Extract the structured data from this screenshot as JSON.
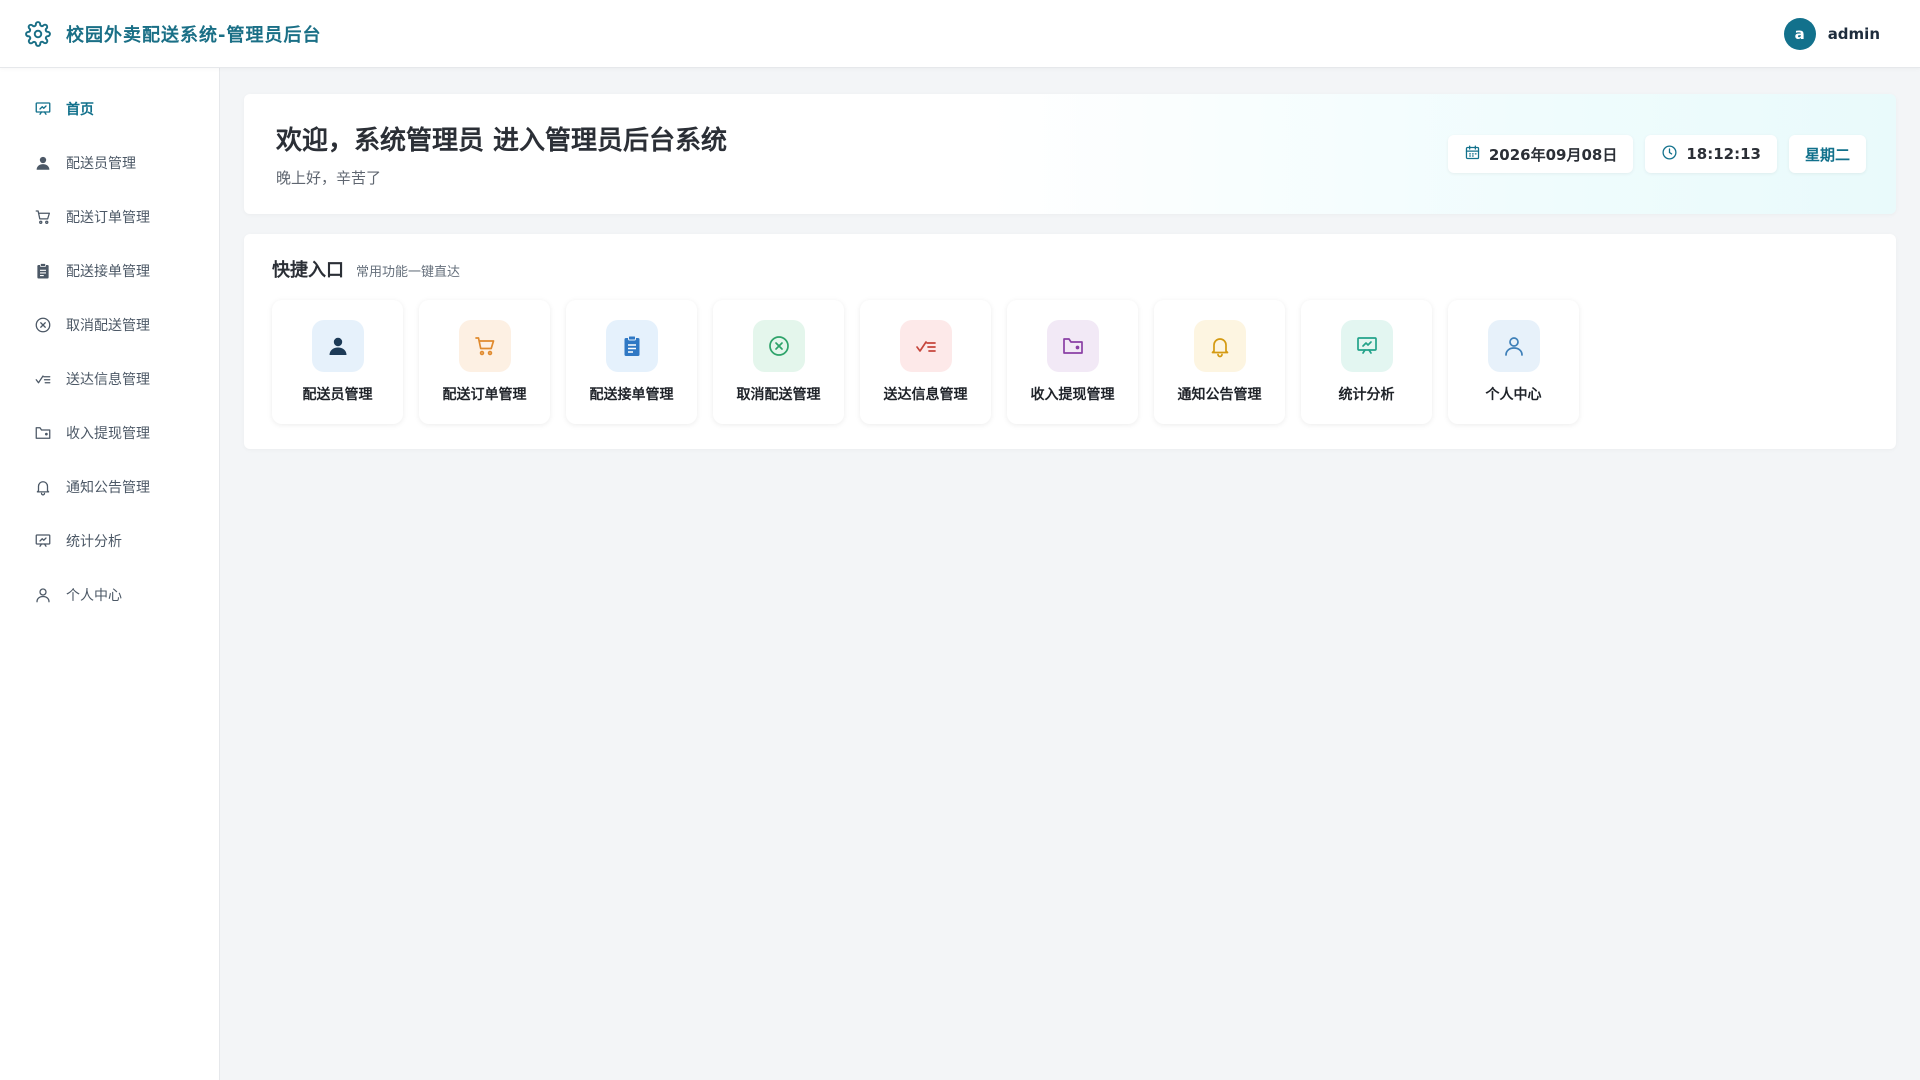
{
  "header": {
    "title": "校园外卖配送系统-管理员后台",
    "logo_icon": "gear-icon",
    "user": {
      "avatar_letter": "a",
      "name": "admin"
    }
  },
  "sidebar": {
    "active_color": "#12718c",
    "items": [
      {
        "label": "首页",
        "icon": "presentation-chart-icon",
        "active": true
      },
      {
        "label": "配送员管理",
        "icon": "user-icon",
        "active": false
      },
      {
        "label": "配送订单管理",
        "icon": "cart-icon",
        "active": false
      },
      {
        "label": "配送接单管理",
        "icon": "clipboard-icon",
        "active": false
      },
      {
        "label": "取消配送管理",
        "icon": "circle-x-icon",
        "active": false
      },
      {
        "label": "送达信息管理",
        "icon": "check-list-icon",
        "active": false
      },
      {
        "label": "收入提现管理",
        "icon": "wallet-icon",
        "active": false
      },
      {
        "label": "通知公告管理",
        "icon": "bell-icon",
        "active": false
      },
      {
        "label": "统计分析",
        "icon": "presentation-chart-icon",
        "active": false
      },
      {
        "label": "个人中心",
        "icon": "user-outline-icon",
        "active": false
      }
    ]
  },
  "welcome": {
    "title": "欢迎，系统管理员 进入管理员后台系统",
    "subtitle": "晚上好，辛苦了",
    "date": "2026年09月08日",
    "time": "18:12:13",
    "weekday": "星期二"
  },
  "quick": {
    "title": "快捷入口",
    "subtitle": "常用功能一键直达",
    "tiles": [
      {
        "label": "配送员管理",
        "icon": "user-icon",
        "bg": "#e6f1fb",
        "color": "#1d3b57"
      },
      {
        "label": "配送订单管理",
        "icon": "cart-icon",
        "bg": "#fdf0e3",
        "color": "#e08a2e"
      },
      {
        "label": "配送接单管理",
        "icon": "clipboard-icon",
        "bg": "#e5f1fc",
        "color": "#2f78c4"
      },
      {
        "label": "取消配送管理",
        "icon": "circle-x-icon",
        "bg": "#e4f6ec",
        "color": "#2ea36a"
      },
      {
        "label": "送达信息管理",
        "icon": "check-list-icon",
        "bg": "#fde9e9",
        "color": "#c6463c"
      },
      {
        "label": "收入提现管理",
        "icon": "wallet-icon",
        "bg": "#f2e9f6",
        "color": "#8a3fa5"
      },
      {
        "label": "通知公告管理",
        "icon": "bell-icon",
        "bg": "#fdf5e1",
        "color": "#d49a12"
      },
      {
        "label": "统计分析",
        "icon": "presentation-chart-icon",
        "bg": "#e3f6f1",
        "color": "#23a38a"
      },
      {
        "label": "个人中心",
        "icon": "user-outline-icon",
        "bg": "#e7f1fa",
        "color": "#3d7fb8"
      }
    ]
  }
}
